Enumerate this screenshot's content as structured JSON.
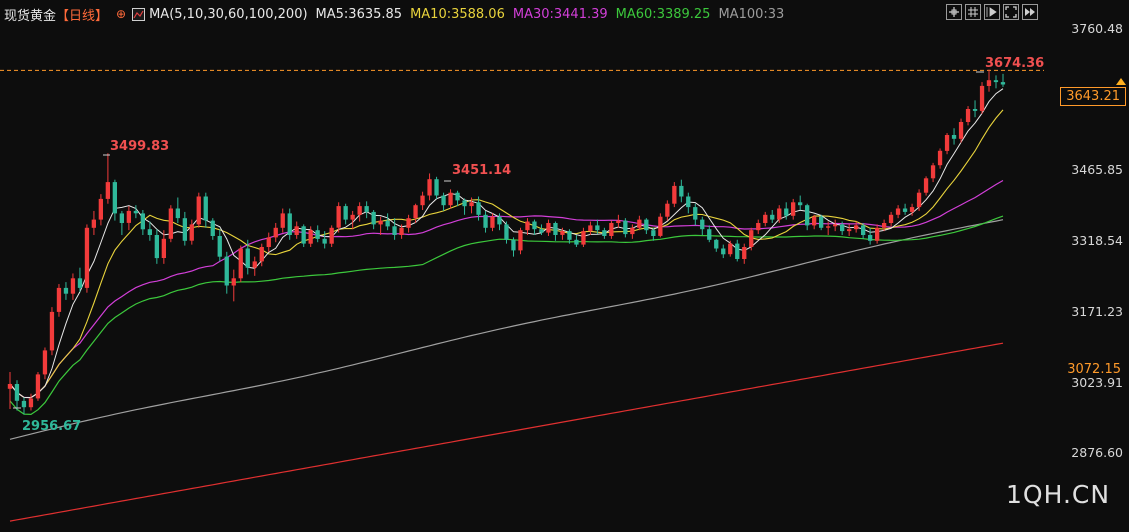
{
  "header": {
    "title": "现货黄金",
    "period": "【日线】",
    "target_icon": "⊕",
    "indicator_icon": "indicator-chart-icon",
    "ma_label": "MA(5,10,30,60,100,200)",
    "ma5": "MA5:3635.85",
    "ma10": "MA10:3588.06",
    "ma30": "MA30:3441.39",
    "ma60": "MA60:3389.25",
    "ma100": "MA100:33"
  },
  "toolbar": {
    "buttons": [
      "crosshair-icon",
      "grid-icon",
      "play-icon",
      "fullscreen-icon",
      "fast-forward-icon"
    ]
  },
  "chart_data": {
    "type": "candlestick",
    "title": "现货黄金 日线",
    "y_axis_ticks": [
      "3760.48",
      "3465.85",
      "3318.54",
      "3171.23",
      "3023.91",
      "2876.60"
    ],
    "ylim": [
      2800,
      3790
    ],
    "current_price": "3643.21",
    "ma200_value": "3072.15",
    "annotations": {
      "high_1": "3499.83",
      "high_2": "3451.14",
      "high_3": "3674.36",
      "low_1": "2956.67"
    },
    "colors": {
      "up": "#f23b3b",
      "down": "#2fb89a",
      "ma5": "#e8e8e8",
      "ma10": "#e8d33c",
      "ma30": "#d23fd8",
      "ma60": "#3cc83c",
      "ma100": "#a0a0a0",
      "ma200": "#e03030",
      "current_line": "#ff9a2a"
    },
    "candles": [
      [
        3010,
        3045,
        2968,
        3020
      ],
      [
        3020,
        3028,
        2965,
        2985
      ],
      [
        2985,
        2992,
        2957,
        2972
      ],
      [
        2972,
        3000,
        2965,
        2990
      ],
      [
        2990,
        3045,
        2985,
        3040
      ],
      [
        3040,
        3096,
        3030,
        3090
      ],
      [
        3090,
        3180,
        3080,
        3170
      ],
      [
        3170,
        3228,
        3160,
        3220
      ],
      [
        3220,
        3232,
        3195,
        3208
      ],
      [
        3208,
        3250,
        3195,
        3240
      ],
      [
        3240,
        3262,
        3212,
        3220
      ],
      [
        3220,
        3352,
        3210,
        3345
      ],
      [
        3345,
        3380,
        3330,
        3362
      ],
      [
        3362,
        3415,
        3350,
        3405
      ],
      [
        3405,
        3500,
        3395,
        3440
      ],
      [
        3440,
        3445,
        3360,
        3375
      ],
      [
        3375,
        3380,
        3330,
        3355
      ],
      [
        3355,
        3390,
        3340,
        3380
      ],
      [
        3380,
        3392,
        3365,
        3375
      ],
      [
        3375,
        3382,
        3330,
        3342
      ],
      [
        3342,
        3358,
        3318,
        3330
      ],
      [
        3330,
        3342,
        3270,
        3282
      ],
      [
        3282,
        3340,
        3270,
        3322
      ],
      [
        3322,
        3392,
        3315,
        3385
      ],
      [
        3385,
        3408,
        3355,
        3365
      ],
      [
        3365,
        3378,
        3308,
        3318
      ],
      [
        3318,
        3362,
        3310,
        3352
      ],
      [
        3352,
        3418,
        3345,
        3410
      ],
      [
        3410,
        3418,
        3345,
        3360
      ],
      [
        3360,
        3365,
        3320,
        3328
      ],
      [
        3328,
        3342,
        3275,
        3285
      ],
      [
        3285,
        3295,
        3208,
        3225
      ],
      [
        3225,
        3258,
        3192,
        3240
      ],
      [
        3240,
        3308,
        3232,
        3302
      ],
      [
        3302,
        3320,
        3248,
        3262
      ],
      [
        3262,
        3285,
        3245,
        3275
      ],
      [
        3275,
        3312,
        3265,
        3305
      ],
      [
        3305,
        3335,
        3295,
        3325
      ],
      [
        3325,
        3355,
        3315,
        3345
      ],
      [
        3345,
        3385,
        3335,
        3375
      ],
      [
        3375,
        3385,
        3320,
        3330
      ],
      [
        3330,
        3358,
        3322,
        3348
      ],
      [
        3348,
        3352,
        3305,
        3312
      ],
      [
        3312,
        3348,
        3305,
        3340
      ],
      [
        3340,
        3350,
        3315,
        3322
      ],
      [
        3322,
        3338,
        3302,
        3312
      ],
      [
        3312,
        3350,
        3305,
        3345
      ],
      [
        3345,
        3398,
        3335,
        3390
      ],
      [
        3390,
        3395,
        3352,
        3362
      ],
      [
        3362,
        3380,
        3342,
        3372
      ],
      [
        3372,
        3398,
        3358,
        3390
      ],
      [
        3390,
        3400,
        3365,
        3378
      ],
      [
        3378,
        3382,
        3342,
        3352
      ],
      [
        3352,
        3368,
        3330,
        3360
      ],
      [
        3360,
        3375,
        3340,
        3348
      ],
      [
        3348,
        3365,
        3320,
        3330
      ],
      [
        3330,
        3352,
        3322,
        3345
      ],
      [
        3345,
        3372,
        3335,
        3365
      ],
      [
        3365,
        3395,
        3355,
        3392
      ],
      [
        3392,
        3420,
        3382,
        3412
      ],
      [
        3412,
        3458,
        3402,
        3446
      ],
      [
        3446,
        3451,
        3405,
        3412
      ],
      [
        3412,
        3418,
        3380,
        3392
      ],
      [
        3392,
        3425,
        3385,
        3418
      ],
      [
        3418,
        3422,
        3390,
        3402
      ],
      [
        3402,
        3406,
        3372,
        3390
      ],
      [
        3390,
        3408,
        3375,
        3398
      ],
      [
        3398,
        3410,
        3360,
        3372
      ],
      [
        3372,
        3380,
        3335,
        3345
      ],
      [
        3345,
        3375,
        3338,
        3368
      ],
      [
        3368,
        3375,
        3340,
        3352
      ],
      [
        3352,
        3358,
        3312,
        3320
      ],
      [
        3320,
        3325,
        3285,
        3298
      ],
      [
        3298,
        3345,
        3290,
        3340
      ],
      [
        3340,
        3365,
        3330,
        3358
      ],
      [
        3358,
        3362,
        3330,
        3342
      ],
      [
        3342,
        3352,
        3330,
        3335
      ],
      [
        3335,
        3362,
        3328,
        3355
      ],
      [
        3355,
        3358,
        3318,
        3330
      ],
      [
        3330,
        3345,
        3320,
        3338
      ],
      [
        3338,
        3342,
        3312,
        3320
      ],
      [
        3320,
        3330,
        3305,
        3310
      ],
      [
        3310,
        3345,
        3305,
        3338
      ],
      [
        3338,
        3358,
        3330,
        3350
      ],
      [
        3350,
        3362,
        3332,
        3340
      ],
      [
        3340,
        3345,
        3322,
        3328
      ],
      [
        3328,
        3360,
        3322,
        3355
      ],
      [
        3355,
        3372,
        3345,
        3360
      ],
      [
        3360,
        3365,
        3325,
        3332
      ],
      [
        3332,
        3352,
        3322,
        3345
      ],
      [
        3345,
        3370,
        3340,
        3362
      ],
      [
        3362,
        3365,
        3332,
        3340
      ],
      [
        3340,
        3345,
        3318,
        3328
      ],
      [
        3328,
        3375,
        3325,
        3368
      ],
      [
        3368,
        3402,
        3360,
        3395
      ],
      [
        3395,
        3440,
        3388,
        3432
      ],
      [
        3432,
        3445,
        3398,
        3410
      ],
      [
        3410,
        3418,
        3375,
        3388
      ],
      [
        3388,
        3395,
        3350,
        3362
      ],
      [
        3362,
        3368,
        3330,
        3342
      ],
      [
        3342,
        3350,
        3315,
        3320
      ],
      [
        3320,
        3322,
        3295,
        3302
      ],
      [
        3302,
        3310,
        3282,
        3290
      ],
      [
        3290,
        3318,
        3285,
        3312
      ],
      [
        3312,
        3320,
        3275,
        3280
      ],
      [
        3280,
        3312,
        3270,
        3305
      ],
      [
        3305,
        3345,
        3298,
        3340
      ],
      [
        3340,
        3362,
        3332,
        3355
      ],
      [
        3355,
        3378,
        3348,
        3372
      ],
      [
        3372,
        3382,
        3355,
        3362
      ],
      [
        3362,
        3392,
        3355,
        3385
      ],
      [
        3385,
        3398,
        3362,
        3370
      ],
      [
        3370,
        3405,
        3362,
        3398
      ],
      [
        3398,
        3412,
        3382,
        3392
      ],
      [
        3392,
        3395,
        3340,
        3350
      ],
      [
        3350,
        3372,
        3342,
        3368
      ],
      [
        3368,
        3372,
        3340,
        3345
      ],
      [
        3345,
        3358,
        3330,
        3348
      ],
      [
        3348,
        3362,
        3338,
        3352
      ],
      [
        3352,
        3358,
        3330,
        3338
      ],
      [
        3338,
        3352,
        3328,
        3342
      ],
      [
        3342,
        3358,
        3335,
        3350
      ],
      [
        3350,
        3355,
        3322,
        3330
      ],
      [
        3330,
        3345,
        3310,
        3318
      ],
      [
        3318,
        3352,
        3312,
        3345
      ],
      [
        3345,
        3362,
        3338,
        3355
      ],
      [
        3355,
        3378,
        3348,
        3372
      ],
      [
        3372,
        3392,
        3365,
        3385
      ],
      [
        3385,
        3395,
        3372,
        3378
      ],
      [
        3378,
        3395,
        3370,
        3388
      ],
      [
        3388,
        3425,
        3380,
        3418
      ],
      [
        3418,
        3452,
        3412,
        3448
      ],
      [
        3448,
        3480,
        3440,
        3475
      ],
      [
        3475,
        3510,
        3468,
        3505
      ],
      [
        3505,
        3542,
        3498,
        3538
      ],
      [
        3538,
        3552,
        3518,
        3530
      ],
      [
        3530,
        3572,
        3522,
        3565
      ],
      [
        3565,
        3598,
        3558,
        3592
      ],
      [
        3592,
        3610,
        3575,
        3588
      ],
      [
        3588,
        3648,
        3582,
        3640
      ],
      [
        3640,
        3674,
        3628,
        3652
      ],
      [
        3652,
        3662,
        3635,
        3648
      ],
      [
        3648,
        3665,
        3638,
        3643
      ]
    ]
  }
}
